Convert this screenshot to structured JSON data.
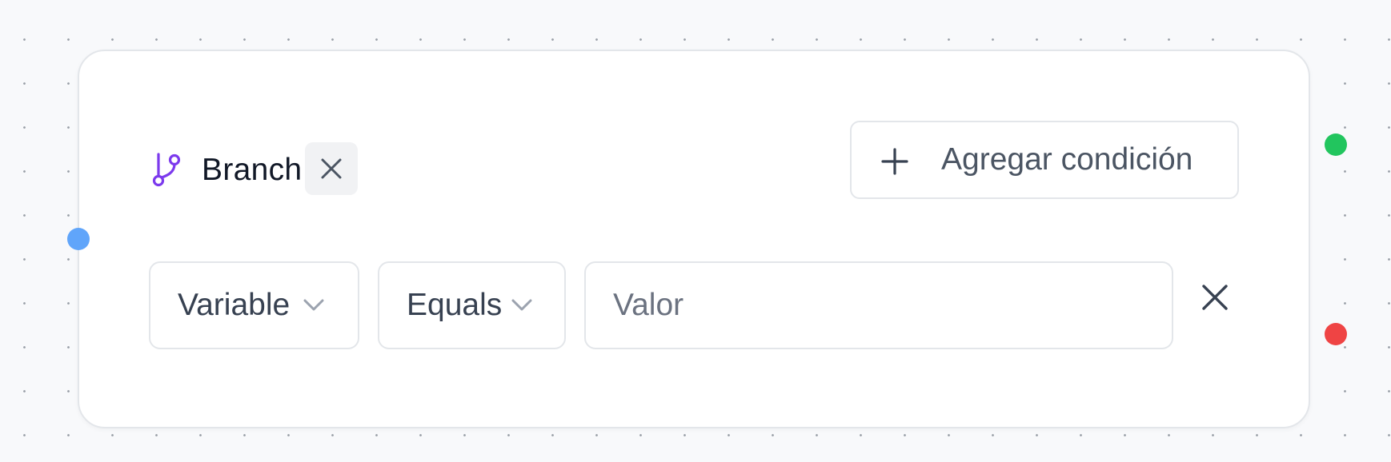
{
  "node": {
    "title": "Branch",
    "add_condition_label": "Agregar condición"
  },
  "condition": {
    "variable_value": "Variable",
    "operator_value": "Equals",
    "value_placeholder": "Valor",
    "value": ""
  },
  "icons": {
    "branch": "git-branch-icon",
    "title_close": "close-icon",
    "add": "plus-icon",
    "dropdown": "chevron-down-icon",
    "row_remove": "close-icon"
  },
  "colors": {
    "canvas_bg": "#f8f9fb",
    "branch_icon": "#7c3aed",
    "input_handle": "#60a5fa",
    "true_handle": "#22c55e",
    "false_handle": "#ef4444"
  }
}
